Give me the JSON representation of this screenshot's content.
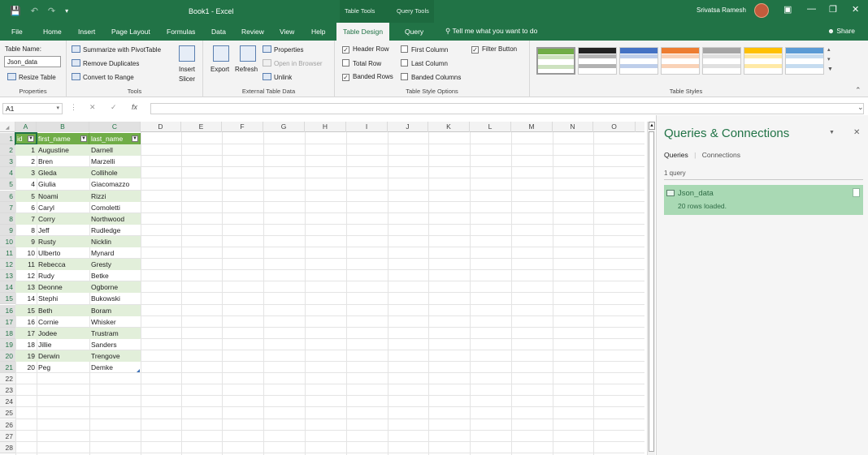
{
  "titlebar": {
    "app_title": "Book1  -  Excel",
    "context_tabs": [
      "Table Tools",
      "Query Tools"
    ],
    "user": "Srivatsa Ramesh",
    "controls": [
      "ribbon-display-icon",
      "minimize-icon",
      "restore-icon",
      "close-icon"
    ]
  },
  "tabs": [
    "File",
    "Home",
    "Insert",
    "Page Layout",
    "Formulas",
    "Data",
    "Review",
    "View",
    "Help",
    "Table Design",
    "Query"
  ],
  "active_tab": "Table Design",
  "tell_me": "Tell me what you want to do",
  "share": "Share",
  "ribbon": {
    "properties": {
      "label": "Properties",
      "table_name_label": "Table Name:",
      "table_name_value": "Json_data",
      "resize": "Resize Table"
    },
    "tools": {
      "label": "Tools",
      "summarize": "Summarize with PivotTable",
      "remove_dup": "Remove Duplicates",
      "convert": "Convert to Range",
      "slicer_line1": "Insert",
      "slicer_line2": "Slicer"
    },
    "external": {
      "label": "External Table Data",
      "export": "Export",
      "refresh": "Refresh",
      "properties": "Properties",
      "open_browser": "Open in Browser",
      "unlink": "Unlink"
    },
    "style_options": {
      "label": "Table Style Options",
      "header_row": "Header Row",
      "total_row": "Total Row",
      "banded_rows": "Banded Rows",
      "first_column": "First Column",
      "last_column": "Last Column",
      "banded_columns": "Banded Columns",
      "filter_button": "Filter Button",
      "checked": {
        "header_row": true,
        "total_row": false,
        "banded_rows": true,
        "first_column": false,
        "last_column": false,
        "banded_columns": false,
        "filter_button": true
      }
    },
    "table_styles": {
      "label": "Table Styles",
      "swatch_colors": [
        "#70ad47",
        "#222222",
        "#4472c4",
        "#ed7d31",
        "#a5a5a5",
        "#ffc000",
        "#5b9bd5"
      ]
    }
  },
  "formula_bar": {
    "name_box": "A1",
    "formula": "",
    "fx": "fx"
  },
  "sheet": {
    "columns": [
      "A",
      "B",
      "C",
      "D",
      "E",
      "F",
      "G",
      "H",
      "I",
      "J",
      "K",
      "L",
      "M",
      "N",
      "O"
    ],
    "row_numbers": [
      "1",
      "2",
      "3",
      "4",
      "5",
      "6",
      "7",
      "8",
      "9",
      "10",
      "11",
      "12",
      "13",
      "14",
      "15",
      "16",
      "17",
      "18",
      "19",
      "20",
      "21",
      "22",
      "23",
      "24",
      "25",
      "26",
      "27",
      "28"
    ],
    "header": [
      "id",
      "first_name",
      "last_name"
    ],
    "rows": [
      [
        "1",
        "Augustine",
        "Darnell"
      ],
      [
        "2",
        "Bren",
        "Marzelli"
      ],
      [
        "3",
        "Gleda",
        "Collihole"
      ],
      [
        "4",
        "Giulia",
        "Giacomazzo"
      ],
      [
        "5",
        "Noami",
        "Rizzi"
      ],
      [
        "6",
        "Caryl",
        "Comoletti"
      ],
      [
        "7",
        "Corry",
        "Northwood"
      ],
      [
        "8",
        "Jeff",
        "Rudledge"
      ],
      [
        "9",
        "Rusty",
        "Nicklin"
      ],
      [
        "10",
        "Ulberto",
        "Mynard"
      ],
      [
        "11",
        "Rebecca",
        "Gresty"
      ],
      [
        "12",
        "Rudy",
        "Betke"
      ],
      [
        "13",
        "Deonne",
        "Ogborne"
      ],
      [
        "14",
        "Stephi",
        "Bukowski"
      ],
      [
        "15",
        "Beth",
        "Boram"
      ],
      [
        "16",
        "Cornie",
        "Whisker"
      ],
      [
        "17",
        "Jodee",
        "Trustram"
      ],
      [
        "18",
        "Jillie",
        "Sanders"
      ],
      [
        "19",
        "Derwin",
        "Trengove"
      ],
      [
        "20",
        "Peg",
        "Demke"
      ]
    ],
    "table_header_color": "#70ad47",
    "band_color": "#e2efda"
  },
  "pane": {
    "title": "Queries & Connections",
    "tab_queries": "Queries",
    "tab_connections": "Connections",
    "count": "1 query",
    "query_name": "Json_data",
    "query_info": "20 rows loaded."
  }
}
